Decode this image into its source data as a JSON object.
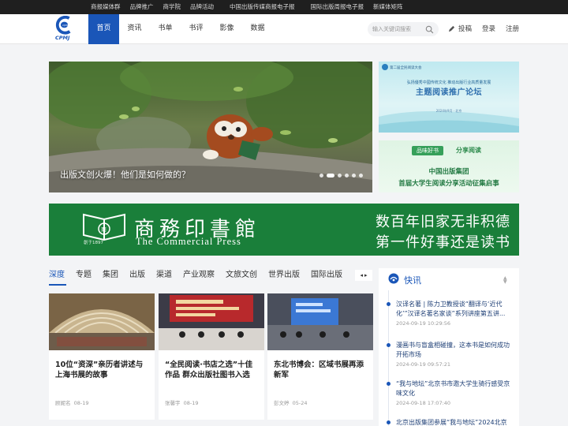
{
  "topbar": {
    "links": [
      "商报媒体群",
      "品牌推广",
      "商学院",
      "品牌活动",
      "中国出版传媒商报电子报",
      "国际出版周报电子报",
      "新媒体矩阵"
    ]
  },
  "header": {
    "logo_text": "CPMJ",
    "nav": [
      "首页",
      "资讯",
      "书单",
      "书评",
      "影像",
      "数据"
    ],
    "active_nav": "首页",
    "search_placeholder": "输入关键词搜索",
    "post_label": "投稿",
    "login_label": "登录",
    "register_label": "注册"
  },
  "hero": {
    "caption": "出版文创火爆！他们是如何做的？",
    "slide_count": 6,
    "active_slide": 1
  },
  "side_promo_1": {
    "small_title": "第二届全民阅读大会",
    "subtitle": "弘扬優秀中國传统文化 推动出版行业高质量发展",
    "headline": "主题阅读推广论坛",
    "footnote": "2024年9月 · 北京"
  },
  "side_promo_2": {
    "tag": "品味好书",
    "tag2": "分享阅读",
    "line1": "中国出版集团",
    "line2": "首届大学生阅读分享活动征集启事"
  },
  "banner": {
    "name_cn": "商務印書館",
    "name_en": "The Commercial Press",
    "established": "創于1897",
    "slogan1": "数百年旧家无非积德",
    "slogan2": "第一件好事还是读书"
  },
  "tabs": {
    "items": [
      "深度",
      "专题",
      "集团",
      "出版",
      "渠道",
      "产业观察",
      "文旅文创",
      "世界出版",
      "国际出版"
    ],
    "active": "深度"
  },
  "cards": [
    {
      "title": "10位“资深”亲历者讲述与上海书展的故事",
      "author": "顾妮名",
      "date": "08-19"
    },
    {
      "title": "“全民阅读·书店之选”十佳作品 群众出版社图书入选",
      "author": "张馨宇",
      "date": "08-19"
    },
    {
      "title": "东北书博会：区域书展再添新军",
      "author": "彭文婷",
      "date": "05-24"
    }
  ],
  "flash": {
    "title": "快讯",
    "items": [
      {
        "text": "汉译名著 | 陈力卫教授谈“翻译与‘近代化’”汉译名著名家谈”系列讲座第五讲...",
        "time": "2024-09-19 10:29:56"
      },
      {
        "text": "漫画书与盲盒相碰撞，这本书是如何成功开拓市场",
        "time": "2024-09-19 09:57:21"
      },
      {
        "text": "“我与地坛”北京书市邀大学生骑行感受京味文化",
        "time": "2024-09-18 17:07:40"
      },
      {
        "text": "北京出版集团参展“我与地坛”2024北京",
        "time": ""
      }
    ]
  },
  "colors": {
    "brand_blue": "#1a56b8",
    "banner_green": "#1a7f3a",
    "topbar_bg": "#1f1f1f"
  }
}
